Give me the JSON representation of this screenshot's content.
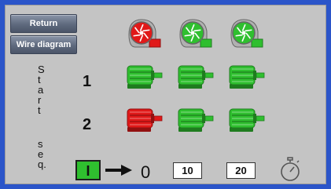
{
  "buttons": {
    "return_label": "Return",
    "wire_label": "Wire diagram"
  },
  "vertical_label": [
    "S",
    "t",
    "a",
    "r",
    "t",
    "",
    "s",
    "e",
    "q."
  ],
  "rows": [
    {
      "label": "1",
      "motors": [
        "green",
        "green",
        "green"
      ]
    },
    {
      "label": "2",
      "motors": [
        "red",
        "green",
        "green"
      ]
    }
  ],
  "fans": [
    "red",
    "green",
    "green"
  ],
  "status": {
    "start_indicator": "I",
    "counter_value": "0",
    "setpoint_a": "10",
    "setpoint_b": "20"
  },
  "icons": {
    "timer": "stopwatch-icon",
    "arrow": "arrow-right-icon",
    "fan": "fan-icon",
    "motor": "motor-icon"
  },
  "colors": {
    "green": "#2fbf2f",
    "red": "#e01919",
    "background": "#2b55c9",
    "panel": "#c4c4c4"
  }
}
